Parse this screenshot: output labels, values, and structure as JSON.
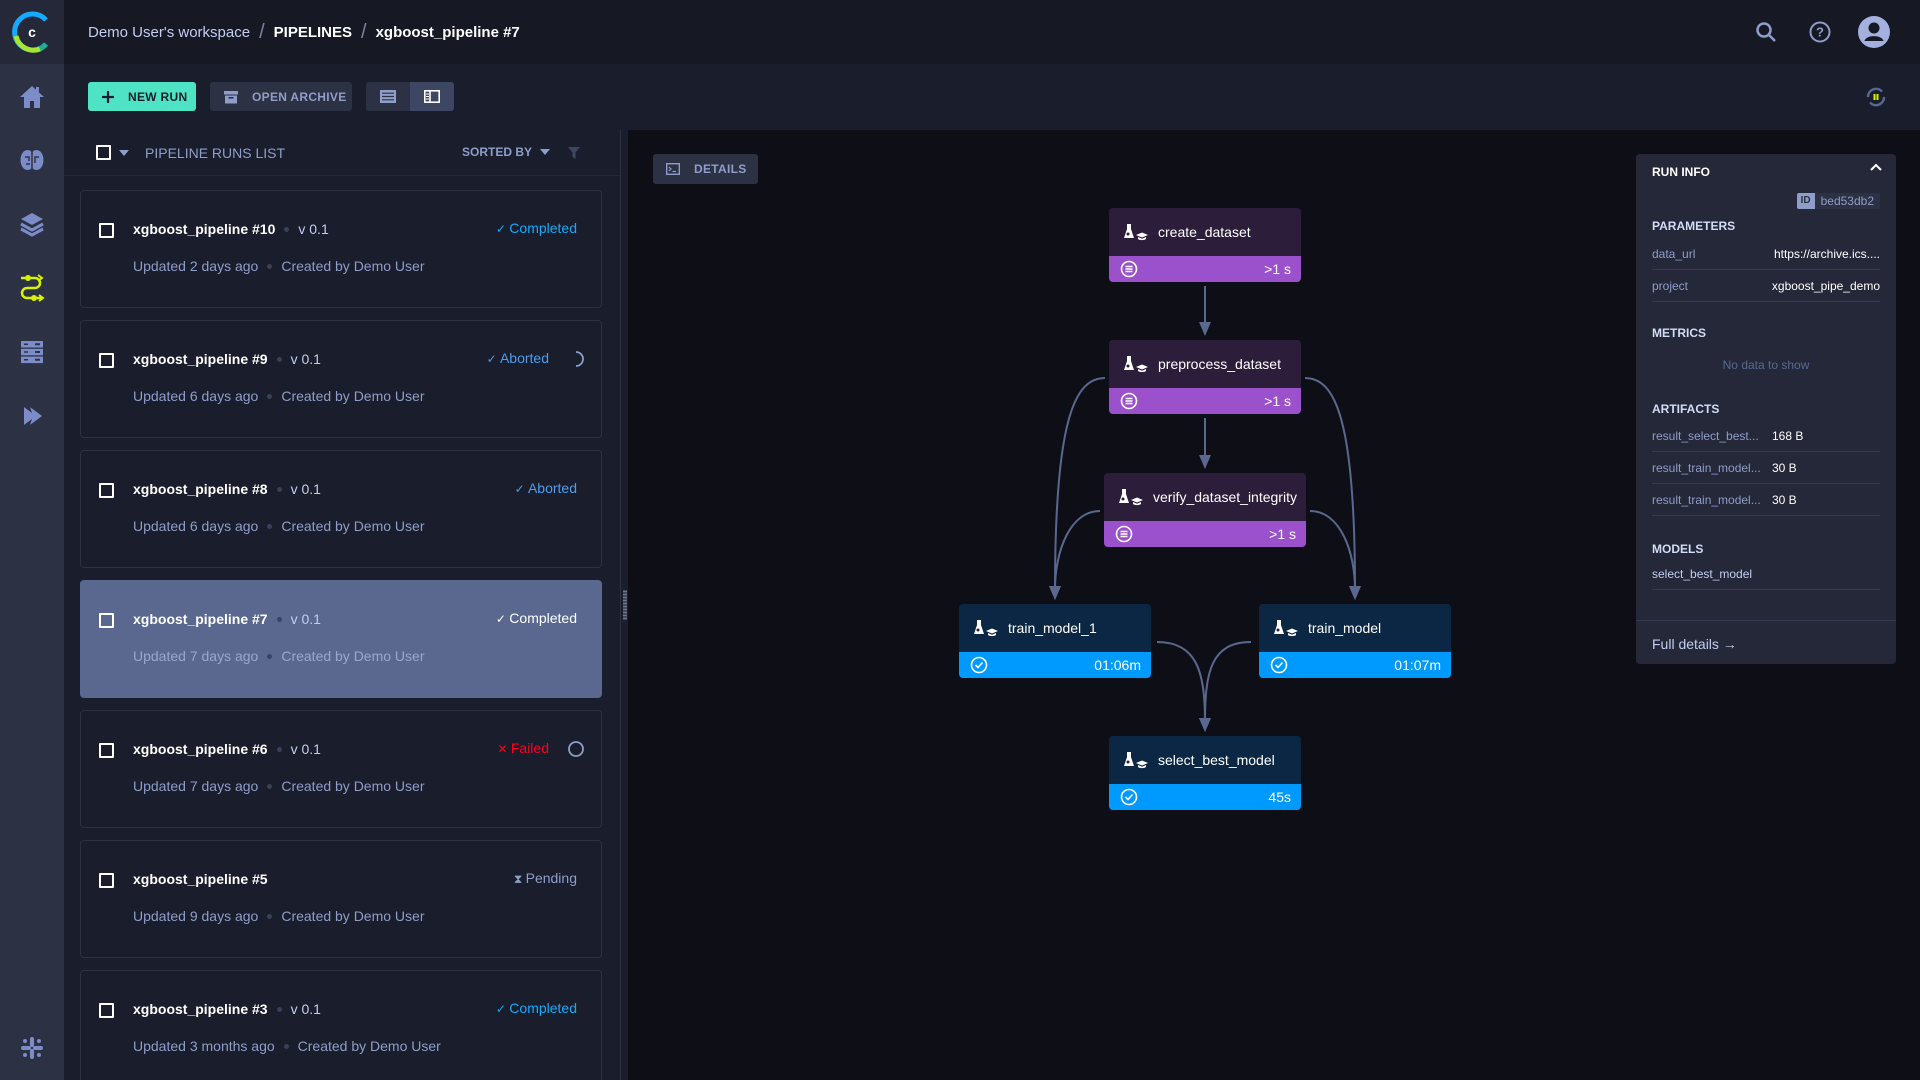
{
  "app": {
    "logo": "ClearML"
  },
  "breadcrumb": {
    "workspace": "Demo User's workspace",
    "section": "PIPELINES",
    "current": "xgboost_pipeline #7",
    "separator": "/"
  },
  "sidebar": {
    "items": [
      {
        "name": "home",
        "icon": "home-icon",
        "active": false
      },
      {
        "name": "projects",
        "icon": "brain-icon",
        "active": false
      },
      {
        "name": "datasets",
        "icon": "layers-icon",
        "active": false
      },
      {
        "name": "pipelines",
        "icon": "pipelines-icon",
        "active": true
      },
      {
        "name": "orchestration",
        "icon": "server-icon",
        "active": false
      },
      {
        "name": "deploy",
        "icon": "chevron-double-right-icon",
        "active": false
      }
    ],
    "footer_icon": "slack-icon"
  },
  "toolbar": {
    "new_run_label": "NEW RUN",
    "open_archive_label": "OPEN ARCHIVE",
    "view_modes": [
      "table-view",
      "details-view"
    ],
    "active_view": "details-view"
  },
  "list": {
    "header_title": "PIPELINE RUNS LIST",
    "sorted_by_label": "SORTED BY",
    "runs": [
      {
        "name": "xgboost_pipeline #10",
        "version": "v 0.1",
        "updated": "Updated 2 days ago",
        "created_by": "Created by Demo User",
        "status": "Completed",
        "status_type": "completed",
        "extra": ""
      },
      {
        "name": "xgboost_pipeline #9",
        "version": "v 0.1",
        "updated": "Updated 6 days ago",
        "created_by": "Created by Demo User",
        "status": "Aborted",
        "status_type": "aborted",
        "extra": "spinner"
      },
      {
        "name": "xgboost_pipeline #8",
        "version": "v 0.1",
        "updated": "Updated 6 days ago",
        "created_by": "Created by Demo User",
        "status": "Aborted",
        "status_type": "aborted",
        "extra": ""
      },
      {
        "name": "xgboost_pipeline #7",
        "version": "v 0.1",
        "updated": "Updated 7 days ago",
        "created_by": "Created by Demo User",
        "status": "Completed",
        "status_type": "completed",
        "extra": "",
        "selected": true
      },
      {
        "name": "xgboost_pipeline #6",
        "version": "v 0.1",
        "updated": "Updated 7 days ago",
        "created_by": "Created by Demo User",
        "status": "Failed",
        "status_type": "failed",
        "extra": "circle"
      },
      {
        "name": "xgboost_pipeline #5",
        "version": "",
        "updated": "Updated 9 days ago",
        "created_by": "Created by Demo User",
        "status": "Pending",
        "status_type": "pending",
        "extra": ""
      },
      {
        "name": "xgboost_pipeline #3",
        "version": "v 0.1",
        "updated": "Updated 3 months ago",
        "created_by": "Created by Demo User",
        "status": "Completed",
        "status_type": "completed",
        "extra": ""
      }
    ]
  },
  "canvas": {
    "details_label": "DETAILS",
    "nodes": [
      {
        "id": "create_dataset",
        "label": "create_dataset",
        "duration": ">1 s",
        "state": "running"
      },
      {
        "id": "preprocess_dataset",
        "label": "preprocess_dataset",
        "duration": ">1 s",
        "state": "running"
      },
      {
        "id": "verify_dataset_integrity",
        "label": "verify_dataset_integrity",
        "duration": ">1 s",
        "state": "running"
      },
      {
        "id": "train_model_1",
        "label": "train_model_1",
        "duration": "01:06m",
        "state": "completed"
      },
      {
        "id": "train_model",
        "label": "train_model",
        "duration": "01:07m",
        "state": "completed"
      },
      {
        "id": "select_best_model",
        "label": "select_best_model",
        "duration": "45s",
        "state": "completed"
      }
    ],
    "edges": [
      [
        "create_dataset",
        "preprocess_dataset"
      ],
      [
        "preprocess_dataset",
        "verify_dataset_integrity"
      ],
      [
        "preprocess_dataset",
        "train_model_1"
      ],
      [
        "preprocess_dataset",
        "train_model"
      ],
      [
        "verify_dataset_integrity",
        "train_model_1"
      ],
      [
        "verify_dataset_integrity",
        "train_model"
      ],
      [
        "train_model_1",
        "select_best_model"
      ],
      [
        "train_model",
        "select_best_model"
      ]
    ]
  },
  "run_info": {
    "title": "RUN INFO",
    "id_tag": "ID",
    "id": "bed53db2",
    "parameters_label": "PARAMETERS",
    "parameters": [
      {
        "key": "data_url",
        "value": "https://archive.ics...."
      },
      {
        "key": "project",
        "value": "xgboost_pipe_demo"
      }
    ],
    "metrics_label": "METRICS",
    "metrics_empty": "No data to show",
    "artifacts_label": "ARTIFACTS",
    "artifacts": [
      {
        "key": "result_select_best...",
        "value": "168 B"
      },
      {
        "key": "result_train_model...",
        "value": "30 B"
      },
      {
        "key": "result_train_model...",
        "value": "30 B"
      }
    ],
    "models_label": "MODELS",
    "models": [
      "select_best_model"
    ],
    "full_details_label": "Full details →"
  },
  "colors": {
    "accent_new_run": "#4ee3c4",
    "active_nav": "#d8f300",
    "running_node": "#9c51cc",
    "completed_node": "#009aff",
    "status_completed": "#14aaff",
    "status_failed": "#ff001f"
  }
}
